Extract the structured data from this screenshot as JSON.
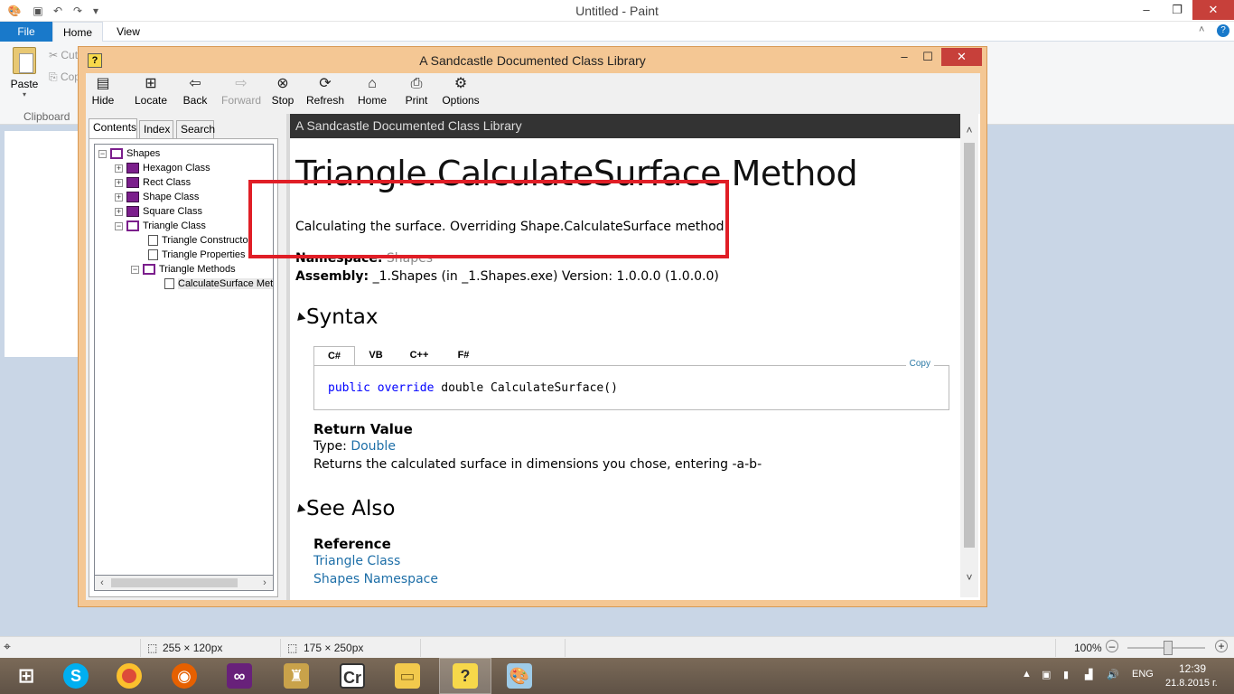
{
  "paint": {
    "title": "Untitled - Paint",
    "tabs": {
      "file": "File",
      "home": "Home",
      "view": "View"
    },
    "paste_label": "Paste",
    "cut_label": "Cut",
    "copy_label": "Copy",
    "clipboard_label": "Clipboard",
    "status": {
      "selection_size": "255 × 120px",
      "canvas_size": "175 × 250px",
      "zoom": "100%"
    }
  },
  "help": {
    "title": "A Sandcastle Documented Class Library",
    "toolbar": {
      "hide": "Hide",
      "locate": "Locate",
      "back": "Back",
      "forward": "Forward",
      "stop": "Stop",
      "refresh": "Refresh",
      "home": "Home",
      "print": "Print",
      "options": "Options"
    },
    "nav_tabs": {
      "contents": "Contents",
      "index": "Index",
      "search": "Search"
    },
    "tree": [
      {
        "label": "Shapes"
      },
      {
        "label": "Hexagon Class"
      },
      {
        "label": "Rect Class"
      },
      {
        "label": "Shape Class"
      },
      {
        "label": "Square Class"
      },
      {
        "label": "Triangle Class"
      },
      {
        "label": "Triangle Constructor"
      },
      {
        "label": "Triangle Properties"
      },
      {
        "label": "Triangle Methods"
      },
      {
        "label": "CalculateSurface Method"
      }
    ],
    "content": {
      "header": "A Sandcastle Documented Class Library",
      "heading": "Triangle.CalculateSurface Method",
      "summary": "Calculating the surface. Overriding Shape.CalculateSurface method",
      "namespace_label": "Namespace:",
      "namespace_value": "Shapes",
      "assembly_label": "Assembly:",
      "assembly_value": "_1.Shapes (in _1.Shapes.exe) Version: 1.0.0.0 (1.0.0.0)",
      "syntax_heading": "Syntax",
      "code_tabs": [
        "C#",
        "VB",
        "C++",
        "F#"
      ],
      "copy": "Copy",
      "code_kw1": "public",
      "code_kw2": "override",
      "code_rest": "double CalculateSurface()",
      "return_heading": "Return Value",
      "type_label": "Type:",
      "type_value": "Double",
      "return_desc": "Returns the calculated surface in dimensions you chose, entering -a-b-",
      "see_also_heading": "See Also",
      "reference_heading": "Reference",
      "ref_links": [
        "Triangle Class",
        "Shapes Namespace"
      ]
    }
  },
  "taskbar": {
    "tray": {
      "language": "ENG",
      "time": "12:39",
      "date": "21.8.2015 г."
    }
  },
  "colors": {
    "help_frame": "#f4c794",
    "highlight": "#e01e26",
    "link": "#1e6fa8",
    "header_bar": "#333333"
  }
}
